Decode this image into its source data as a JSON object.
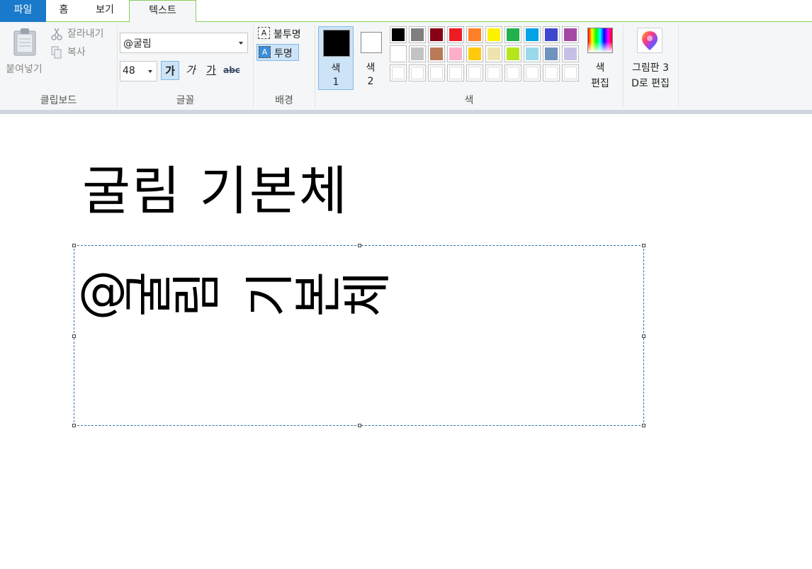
{
  "tabs": {
    "file": "파일",
    "home": "홈",
    "view": "보기",
    "text": "텍스트"
  },
  "clipboard": {
    "paste": "붙여넣기",
    "cut": "잘라내기",
    "copy": "복사",
    "label": "클립보드"
  },
  "font": {
    "name": "@굴림",
    "size": "48",
    "bold": "가",
    "italic": "가",
    "underline": "가",
    "strike": "abc",
    "label": "글꼴"
  },
  "background": {
    "opaque": "불투명",
    "transparent": "투명",
    "transparent_icon": "A",
    "opaque_icon": "A",
    "label": "배경"
  },
  "colors": {
    "color1_line1": "색",
    "color1_line2": "1",
    "color1_value": "#000000",
    "color2_line1": "색",
    "color2_line2": "2",
    "color2_value": "#ffffff",
    "edit_line1": "색",
    "edit_line2": "편집",
    "label": "색",
    "palette": [
      [
        "#000000",
        "#7f7f7f",
        "#880015",
        "#ed1c24",
        "#ff7f27",
        "#fff200",
        "#22b14c",
        "#00a2e8",
        "#3f48cc",
        "#a349a4"
      ],
      [
        "#ffffff",
        "#c3c3c3",
        "#b97a57",
        "#ffaec9",
        "#ffc90e",
        "#efe4b0",
        "#b5e61d",
        "#99d9ea",
        "#7092be",
        "#c8bfe7"
      ],
      [
        "",
        "",
        "",
        "",
        "",
        "",
        "",
        "",
        "",
        ""
      ]
    ]
  },
  "paint3d": {
    "line1": "그림판 3",
    "line2": "D로 편집"
  },
  "canvas": {
    "text_line1": "굴림 기본체",
    "text_line2_at": "@",
    "text_line2_glyphs": [
      "굴",
      "림",
      "",
      "기",
      "본",
      "체"
    ]
  }
}
